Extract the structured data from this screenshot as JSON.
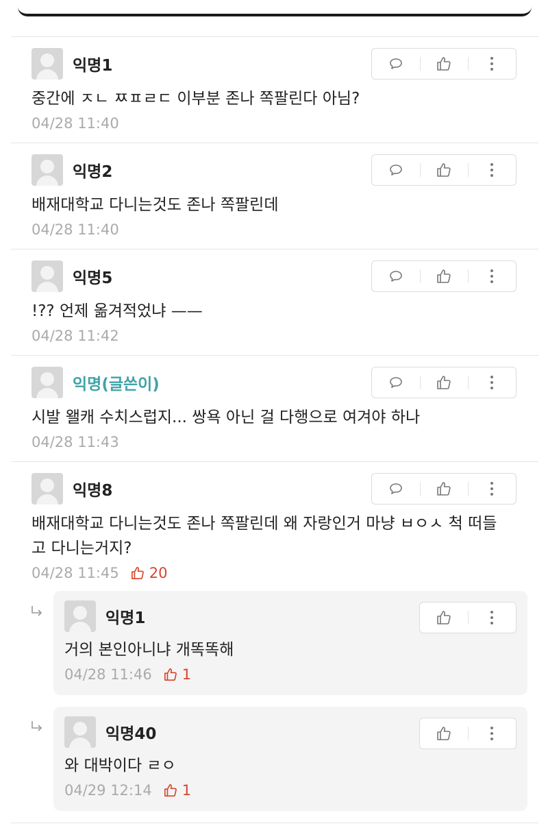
{
  "comments": [
    {
      "author": "익명1",
      "text": "중간에 ㅈㄴ ㅉㅍㄹㄷ 이부분 존나 쪽팔린다 아님?",
      "time": "04/28 11:40"
    },
    {
      "author": "익명2",
      "text": "배재대학교 다니는것도 존나 쪽팔린데",
      "time": "04/28 11:40"
    },
    {
      "author": "익명5",
      "text": "!?? 언제 옮겨적었냐 ——",
      "time": "04/28 11:42"
    },
    {
      "author": "익명(글쓴이)",
      "text": "시발 왤캐 수치스럽지... 쌍욕 아닌 걸 다행으로 여겨야 하나",
      "time": "04/28 11:43"
    },
    {
      "author": "익명8",
      "text": "배재대학교 다니는것도 존나 쪽팔린데 왜 자랑인거 마냥 ㅂㅇㅅ 척 떠들고 다니는거지?",
      "time": "04/28 11:45",
      "likes": "20"
    }
  ],
  "replies": [
    {
      "author": "익명1",
      "text": "거의 본인아니냐 개똑똑해",
      "time": "04/28 11:46",
      "likes": "1"
    },
    {
      "author": "익명40",
      "text": "와 대박이다 ㄹㅇ",
      "time": "04/29 12:14",
      "likes": "1"
    }
  ],
  "icons": {
    "reply": "speech-bubble-icon",
    "like": "thumbs-up-icon",
    "more": "more-vertical-icon",
    "reply_indent": "reply-arrow-icon"
  },
  "colors": {
    "op_name": "#3fa3a8",
    "like_red": "#d9442c",
    "meta_gray": "#aaaaaa"
  }
}
